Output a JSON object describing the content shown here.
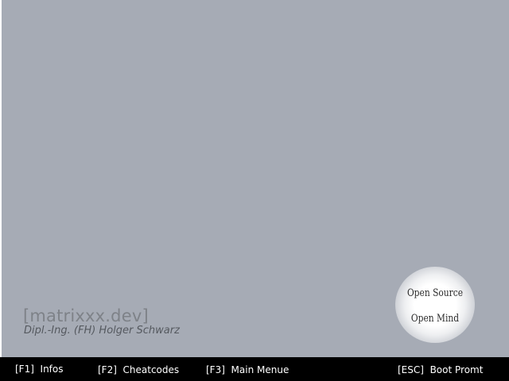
{
  "brand": {
    "title": "[matrixxx.dev]",
    "author": "Dipl.-Ing. (FH) Holger Schwarz"
  },
  "badge": {
    "line1": "Open Source",
    "line2": "Open Mind"
  },
  "footer": {
    "f1": "[F1]  Infos",
    "f2": "[F2]  Cheatcodes",
    "f3": "[F3]  Main Menue",
    "esc": "[ESC]  Boot Promt"
  },
  "colors": {
    "background": "#a6abb5",
    "footer": "#000000",
    "footer_text": "#ffffff"
  }
}
